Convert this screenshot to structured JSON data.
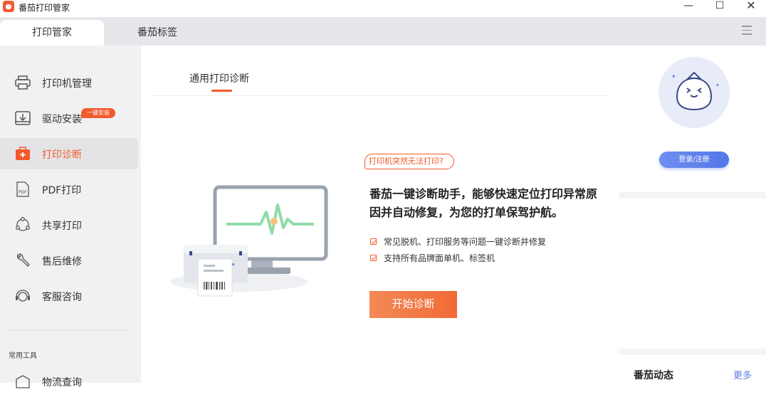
{
  "window": {
    "title": "番茄打印管家",
    "controls": {
      "minimize": "—",
      "maximize": "☐",
      "close": "✕"
    }
  },
  "tabs": [
    {
      "label": "打印管家",
      "active": true
    },
    {
      "label": "番茄标签",
      "active": false
    }
  ],
  "sidebar": {
    "items": [
      {
        "label": "打印机管理",
        "icon": "printer-icon"
      },
      {
        "label": "驱动安装",
        "icon": "driver-download-icon",
        "badge": "一键安装"
      },
      {
        "label": "打印诊断",
        "icon": "toolbox-icon",
        "active": true
      },
      {
        "label": "PDF打印",
        "icon": "pdf-icon"
      },
      {
        "label": "共享打印",
        "icon": "share-icon"
      },
      {
        "label": "售后维修",
        "icon": "wrench-icon"
      },
      {
        "label": "客服咨询",
        "icon": "headset-icon"
      }
    ],
    "section_title": "常用工具",
    "tools": [
      {
        "label": "物流查询",
        "icon": "logistics-icon"
      }
    ]
  },
  "main": {
    "subtab": "通用打印诊断",
    "bubble": "打印机突然无法打印?",
    "headline": "番茄一键诊断助手，能够快速定位打印异常原因并自动修复，为您的打单保驾护航。",
    "features": [
      "常见脱机、打印服务等问题一键诊断并修复",
      "支持所有品牌面单机、标签机"
    ],
    "start_button": "开始诊断"
  },
  "right_panel": {
    "login_button": "登录/注册",
    "news_title": "番茄动态",
    "news_more": "更多"
  },
  "colors": {
    "accent": "#f25a2c",
    "login": "#5b7be6",
    "sidebar_bg": "#f1f1f3",
    "tabstrip_bg": "#e6e7ea"
  }
}
